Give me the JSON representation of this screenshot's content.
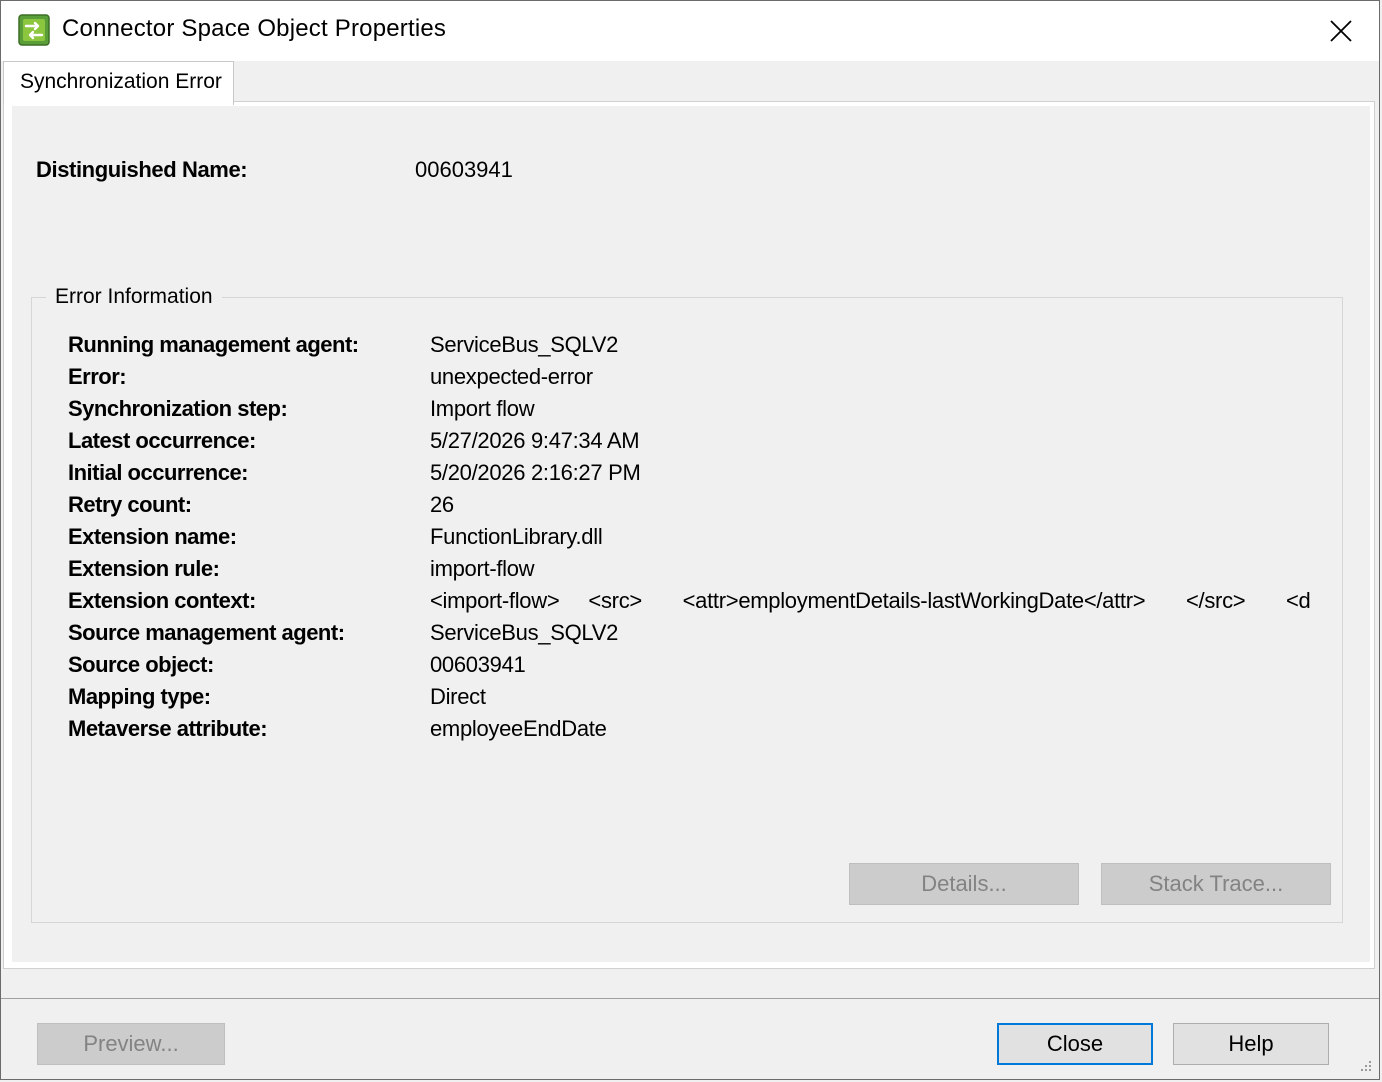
{
  "window": {
    "title": "Connector Space Object Properties",
    "icon": "sync-arrows-icon",
    "accent_color": "#4caf50"
  },
  "tabs": [
    {
      "label": "Synchronization Error",
      "selected": true
    }
  ],
  "distinguished_name": {
    "label": "Distinguished Name:",
    "value": "00603941"
  },
  "error_info": {
    "legend": "Error Information",
    "rows": [
      {
        "label": "Running management agent:",
        "value": "ServiceBus_SQLV2"
      },
      {
        "label": "Error:",
        "value": "unexpected-error"
      },
      {
        "label": "Synchronization step:",
        "value": "Import flow"
      },
      {
        "label": "Latest occurrence:",
        "value": "5/27/2026 9:47:34 AM"
      },
      {
        "label": "Initial occurrence:",
        "value": "5/20/2026 2:16:27 PM"
      },
      {
        "label": "Retry count:",
        "value": "26"
      },
      {
        "label": "Extension name:",
        "value": "FunctionLibrary.dll"
      },
      {
        "label": "Extension rule:",
        "value": "import-flow"
      },
      {
        "label": "Extension context:",
        "value": "<import-flow>     <src>       <attr>employmentDetails-lastWorkingDate</attr>       </src>       <d"
      },
      {
        "label": "Source management agent:",
        "value": "ServiceBus_SQLV2"
      },
      {
        "label": "Source object:",
        "value": "00603941"
      },
      {
        "label": "Mapping type:",
        "value": "Direct"
      },
      {
        "label": "Metaverse attribute:",
        "value": "employeeEndDate"
      }
    ],
    "details_button": "Details...",
    "stack_trace_button": "Stack Trace..."
  },
  "footer": {
    "preview_button": "Preview...",
    "close_button": "Close",
    "help_button": "Help"
  }
}
